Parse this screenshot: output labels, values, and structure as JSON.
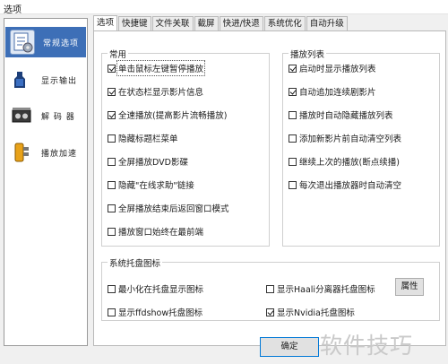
{
  "window": {
    "title": "选项"
  },
  "sidebar": {
    "items": [
      {
        "label": "常规选项",
        "icon": "settings-notepad-icon",
        "selected": true
      },
      {
        "label": "显示输出",
        "icon": "display-output-icon",
        "selected": false
      },
      {
        "label": "解 码 器",
        "icon": "decoder-icon",
        "selected": false
      },
      {
        "label": "播放加速",
        "icon": "playback-accelerate-icon",
        "selected": false
      }
    ]
  },
  "tabs": [
    {
      "label": "选项",
      "active": true
    },
    {
      "label": "快捷键",
      "active": false
    },
    {
      "label": "文件关联",
      "active": false
    },
    {
      "label": "截屏",
      "active": false
    },
    {
      "label": "快进/快退",
      "active": false
    },
    {
      "label": "系统优化",
      "active": false
    },
    {
      "label": "自动升级",
      "active": false
    }
  ],
  "groups": {
    "common": {
      "title": "常用",
      "items": [
        {
          "label": "单击鼠标左键暂停播放",
          "checked": true
        },
        {
          "label": "在状态栏显示影片信息",
          "checked": true
        },
        {
          "label": "全速播放(提高影片流畅播放)",
          "checked": true
        },
        {
          "label": "隐藏标题栏菜单",
          "checked": false
        },
        {
          "label": "全屏播放DVD影碟",
          "checked": false
        },
        {
          "label": "隐藏\"在线求助\"链接",
          "checked": false
        },
        {
          "label": "全屏播放结束后返回窗口模式",
          "checked": false
        },
        {
          "label": "播放窗口始终在最前端",
          "checked": false
        }
      ]
    },
    "playlist": {
      "title": "播放列表",
      "items": [
        {
          "label": "启动时显示播放列表",
          "checked": true
        },
        {
          "label": "自动追加连续剧影片",
          "checked": true
        },
        {
          "label": "播放时自动隐藏播放列表",
          "checked": false
        },
        {
          "label": "添加新影片前自动清空列表",
          "checked": false
        },
        {
          "label": "继续上次的播放(断点续播)",
          "checked": false
        },
        {
          "label": "每次退出播放器时自动清空",
          "checked": false
        }
      ]
    },
    "tray": {
      "title": "系统托盘图标",
      "items": [
        {
          "label": "最小化在托盘显示图标",
          "checked": false
        },
        {
          "label": "显示Haali分离器托盘图标",
          "checked": false
        },
        {
          "label": "显示ffdshow托盘图标",
          "checked": false
        },
        {
          "label": "显示Nvidia托盘图标",
          "checked": true
        }
      ],
      "properties_label": "属性"
    }
  },
  "footer": {
    "ok_label": "确定"
  },
  "watermark": "软件技巧",
  "colors": {
    "selection": "#3d6fb7",
    "window_bg": "#f0f0f0",
    "panel_border": "#9a9a9a"
  }
}
